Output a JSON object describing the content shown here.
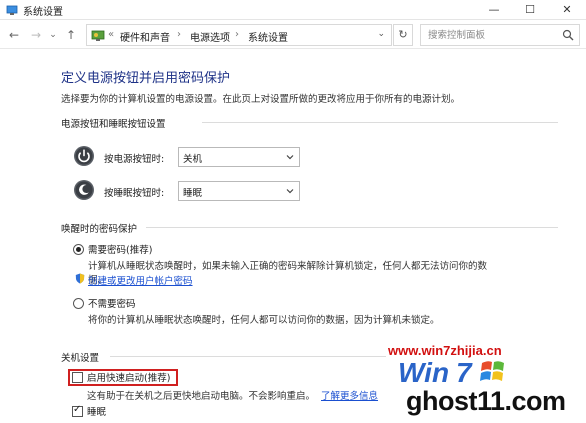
{
  "window": {
    "title": "系统设置",
    "minimize_glyph": "—",
    "maximize_glyph": "☐",
    "close_glyph": "✕"
  },
  "nav": {
    "back_glyph": "←",
    "forward_glyph": "→",
    "history_glyph": "⌄",
    "up_glyph": "↑",
    "overflow_glyph": "«",
    "breadcrumbs": [
      "硬件和声音",
      "电源选项",
      "系统设置"
    ],
    "separator": "›",
    "dropdown_glyph": "⌄",
    "refresh_glyph": "↻",
    "search_placeholder": "搜索控制面板"
  },
  "page": {
    "title": "定义电源按钮并启用密码保护",
    "subtitle": "选择要为你的计算机设置的电源设置。在此页上对设置所做的更改将应用于你所有的电源计划。"
  },
  "power_section": {
    "header": "电源按钮和睡眠按钮设置",
    "rows": [
      {
        "label": "按电源按钮时:",
        "value": "关机",
        "icon": "power-button-icon"
      },
      {
        "label": "按睡眠按钮时:",
        "value": "睡眠",
        "icon": "sleep-button-icon"
      }
    ]
  },
  "wake_section": {
    "header": "唤醒时的密码保护",
    "option1": {
      "label": "需要密码(推荐)",
      "selected": true,
      "desc_line1": "计算机从睡眠状态唤醒时，如果未输入正确的密码来解除计算机锁定，任何人都无法访问你的数",
      "desc_line2": "据。",
      "link": "创建或更改用户帐户密码"
    },
    "option2": {
      "label": "不需要密码",
      "selected": false,
      "desc": "将你的计算机从睡眠状态唤醒时，任何人都可以访问你的数据，因为计算机未锁定。"
    }
  },
  "shutdown_section": {
    "header": "关机设置",
    "fast_startup": {
      "label": "启用快速启动(推荐)",
      "checked": false,
      "desc": "这有助于在关机之后更快地启动电脑。不会影响重启。",
      "link": "了解更多信息"
    },
    "sleep": {
      "label": "睡眠",
      "checked": true
    }
  },
  "watermark": {
    "url": "www.win7zhijia.cn",
    "ghost": "ghost11.com"
  },
  "colors": {
    "title_blue": "#1e3287",
    "link_blue": "#1a4fd0",
    "highlight_red": "#d02020",
    "watermark_red": "#d21010"
  }
}
